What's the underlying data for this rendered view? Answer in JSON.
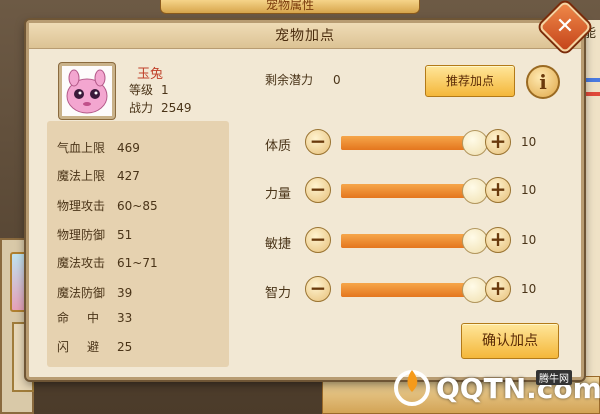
{
  "background": {
    "top_banner": "宠物属性",
    "right_label": "能"
  },
  "dialog": {
    "title": "宠物加点",
    "close_glyph": "✕"
  },
  "pet": {
    "name": "玉兔",
    "level_label": "等级",
    "level": "1",
    "power_label": "战力",
    "power": "2549"
  },
  "stats": [
    {
      "label": "气血上限",
      "value": "469"
    },
    {
      "label": "魔法上限",
      "value": "427"
    },
    {
      "label": "物理攻击",
      "value": "60~85"
    },
    {
      "label": "物理防御",
      "value": "51"
    },
    {
      "label": "魔法攻击",
      "value": "61~71"
    },
    {
      "label": "魔法防御",
      "value": "39"
    },
    {
      "label": "命中",
      "value": "33"
    },
    {
      "label": "闪避",
      "value": "25"
    }
  ],
  "potential": {
    "label": "剩余潜力",
    "value": "0"
  },
  "buttons": {
    "recommend": "推荐加点",
    "info": "i",
    "confirm": "确认加点",
    "minus": "−",
    "plus": "+"
  },
  "attributes": [
    {
      "label": "体质",
      "value": "10",
      "level": 1.0
    },
    {
      "label": "力量",
      "value": "10",
      "level": 1.0
    },
    {
      "label": "敏捷",
      "value": "10",
      "level": 1.0
    },
    {
      "label": "智力",
      "value": "10",
      "level": 1.0
    }
  ],
  "watermark": {
    "text": "QQTN.com",
    "tag": "腾牛网"
  },
  "colors": {
    "accent_orange": "#e4761e",
    "button_gold": "#f4b73a",
    "close_red": "#c4431a"
  }
}
